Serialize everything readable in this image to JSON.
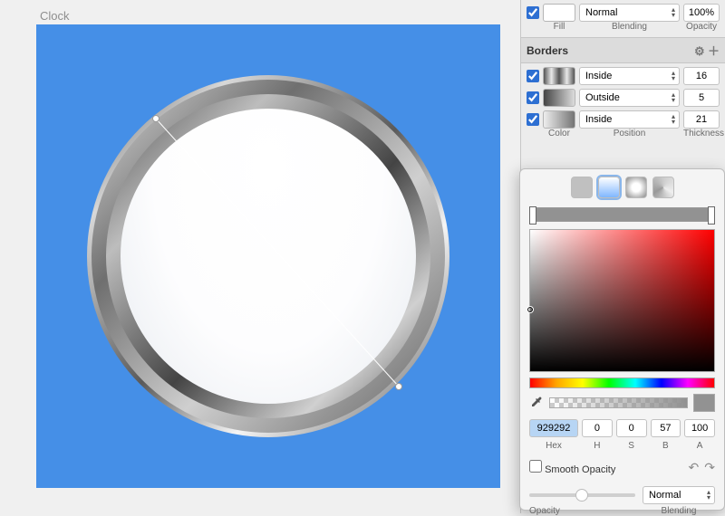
{
  "canvas": {
    "label": "Clock",
    "bg": "#458FE7"
  },
  "fill": {
    "enabled": true,
    "blend_mode": "Normal",
    "opacity": "100%",
    "labels": {
      "fill": "Fill",
      "blending": "Blending",
      "opacity": "Opacity"
    }
  },
  "borders": {
    "title": "Borders",
    "labels": {
      "color": "Color",
      "position": "Position",
      "thickness": "Thickness"
    },
    "items": [
      {
        "enabled": true,
        "position": "Inside",
        "thickness": "16"
      },
      {
        "enabled": true,
        "position": "Outside",
        "thickness": "5"
      },
      {
        "enabled": true,
        "position": "Inside",
        "thickness": "21"
      }
    ]
  },
  "color_picker": {
    "hex": "929292",
    "h": "0",
    "s": "0",
    "b": "57",
    "a": "100",
    "labels": {
      "hex": "Hex",
      "h": "H",
      "s": "S",
      "b": "B",
      "a": "A"
    },
    "smooth_opacity_label": "Smooth Opacity",
    "smooth_opacity": false,
    "blend_mode": "Normal",
    "bottom_labels": {
      "opacity": "Opacity",
      "blending": "Blending"
    }
  }
}
